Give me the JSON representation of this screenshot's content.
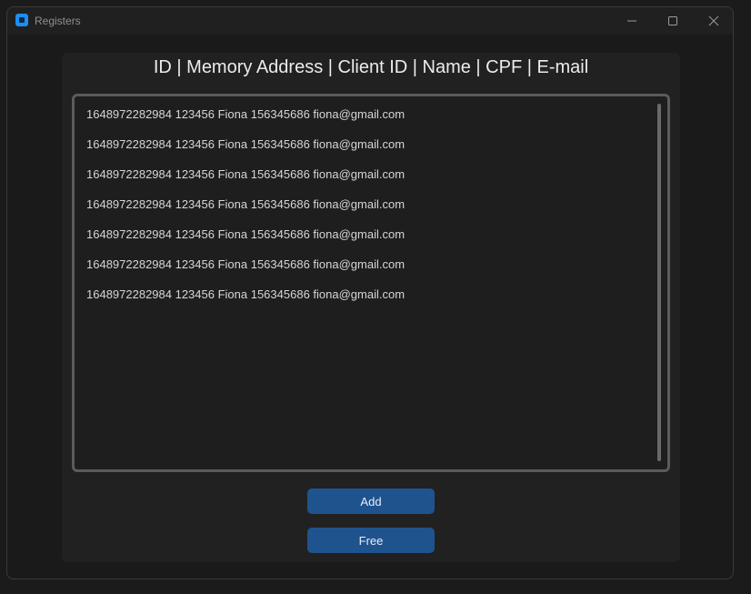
{
  "window": {
    "title": "Registers",
    "controls": {
      "minimize": "minimize-icon",
      "maximize": "maximize-icon",
      "close": "close-icon"
    }
  },
  "header": {
    "label": "ID | Memory Address | Client ID | Name | CPF | E-mail"
  },
  "registers": [
    "1648972282984 123456 Fiona 156345686 fiona@gmail.com",
    "1648972282984 123456 Fiona 156345686 fiona@gmail.com",
    "1648972282984 123456 Fiona 156345686 fiona@gmail.com",
    "1648972282984 123456 Fiona 156345686 fiona@gmail.com",
    "1648972282984 123456 Fiona 156345686 fiona@gmail.com",
    "1648972282984 123456 Fiona 156345686 fiona@gmail.com",
    "1648972282984 123456 Fiona 156345686 fiona@gmail.com"
  ],
  "buttons": {
    "add_label": "Add",
    "free_label": "Free"
  },
  "colors": {
    "accent": "#1f538d",
    "app_icon": "#1f8ef1",
    "background": "#1a1a1a",
    "panel": "#212121"
  }
}
